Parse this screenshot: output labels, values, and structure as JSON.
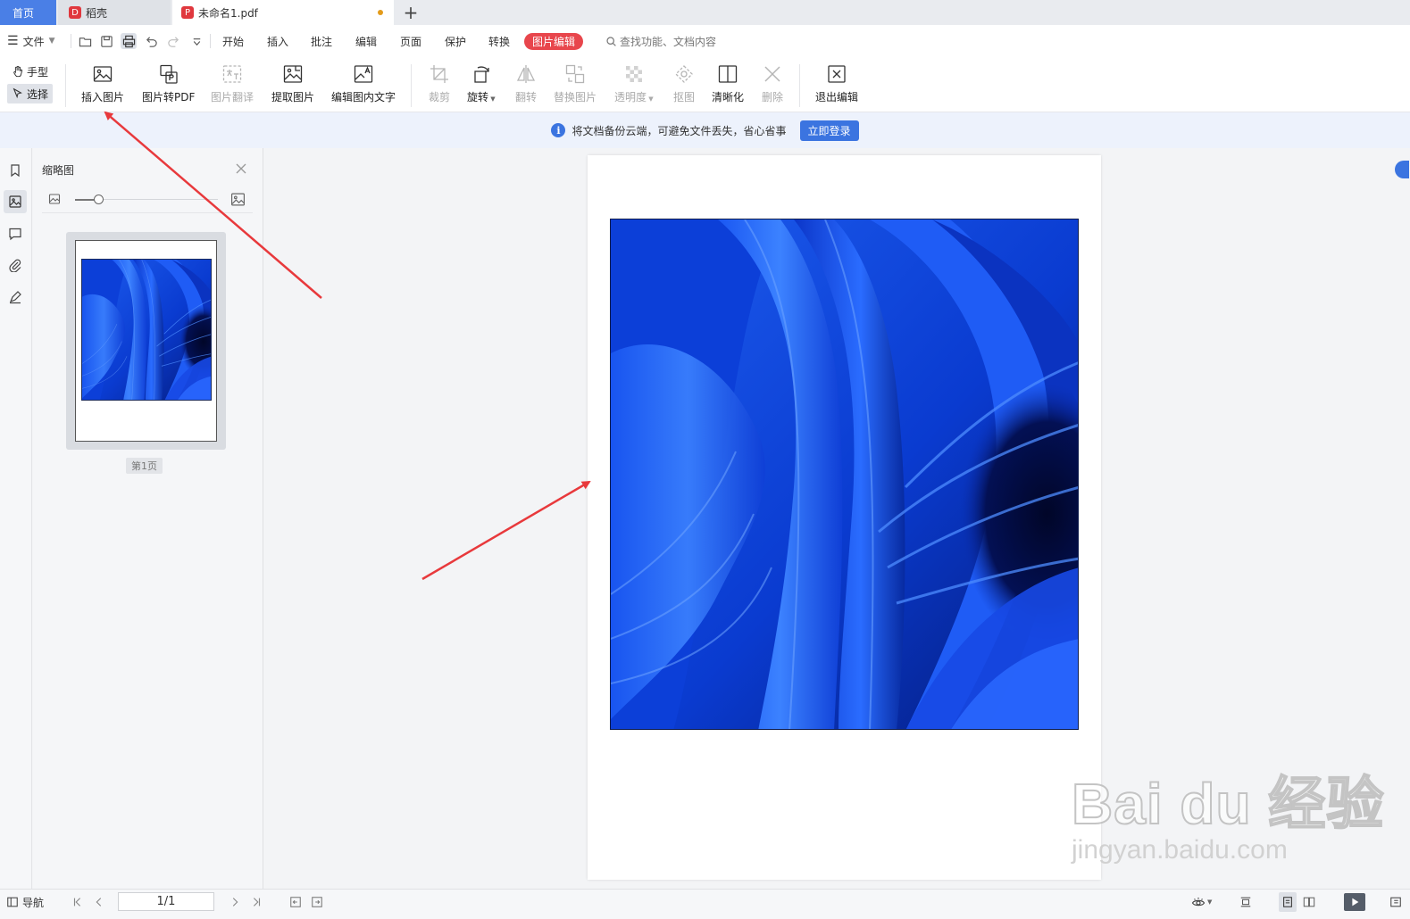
{
  "tabs": {
    "home": "首页",
    "daoke": "稻壳",
    "document": "未命名1.pdf",
    "add": "+"
  },
  "menu": {
    "file": "文件",
    "items": [
      "开始",
      "插入",
      "批注",
      "编辑",
      "页面",
      "保护",
      "转换"
    ],
    "active": "图片编辑",
    "search_placeholder": "查找功能、文档内容"
  },
  "ribbon": {
    "hand_mode": "手型",
    "select_mode": "选择",
    "insert_image": "插入图片",
    "image_to_pdf": "图片转PDF",
    "image_translate": "图片翻译",
    "extract_image": "提取图片",
    "edit_image_text": "编辑图内文字",
    "crop": "裁剪",
    "rotate": "旋转",
    "flip": "翻转",
    "replace_image": "替换图片",
    "transparency": "透明度",
    "cutout": "抠图",
    "sharpen": "清晰化",
    "delete": "删除",
    "exit_edit": "退出编辑"
  },
  "notice": {
    "message": "将文档备份云端，可避免文件丢失，省心省事",
    "button": "立即登录"
  },
  "thumbnail_panel": {
    "title": "缩略图",
    "zoom_level": 0.16,
    "page_label": "第1页"
  },
  "status": {
    "nav": "导航",
    "page_value": "1/1"
  },
  "watermark": {
    "main": "Bai du 经验",
    "sub": "jingyan.baidu.com"
  },
  "colors": {
    "accent": "#3b74e0",
    "active_tab_pill": "#e8464c",
    "annotation_arrow": "#e8393c"
  }
}
